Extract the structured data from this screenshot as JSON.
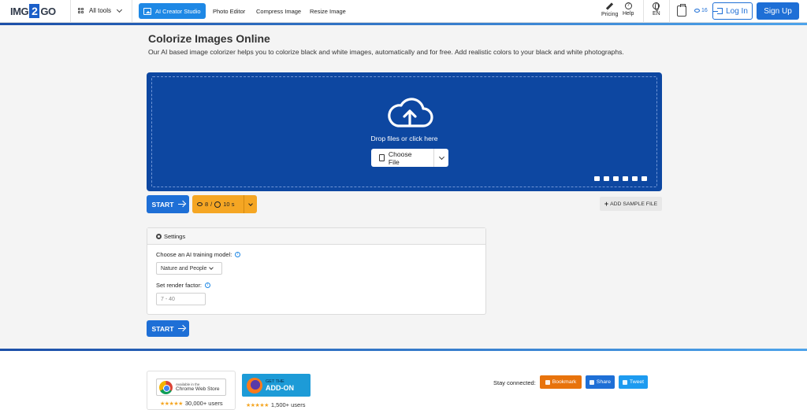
{
  "header": {
    "logo": {
      "pre": "IMG",
      "mid": "2",
      "post": "GO"
    },
    "all_tools": "All tools",
    "ai_button": "AI Creator Studio",
    "nav": [
      "Photo Editor",
      "Compress Image",
      "Resize Image"
    ],
    "pricing": "Pricing",
    "help": "Help",
    "help_icon_glyph": "?",
    "language": "EN",
    "credits": "16",
    "login": "Log In",
    "signup": "Sign Up"
  },
  "main": {
    "title": "Colorize Images Online",
    "subtitle": "Our AI based image colorizer helps you to colorize black and white images, automatically and for free. Add realistic colors to your black and white photographs.",
    "dropzone": {
      "text": "Drop files or click here",
      "choose_file": "Choose File",
      "source_icons": [
        "folder-icon",
        "link-icon",
        "google-drive-icon",
        "onedrive-icon",
        "dropbox-icon",
        "clipboard-icon"
      ]
    },
    "start": "START",
    "cost": {
      "credits": "8",
      "separator": "/",
      "time": "10 s"
    },
    "add_sample": "ADD SAMPLE FILE",
    "settings": {
      "title": "Settings",
      "model_label": "Choose an AI training model:",
      "model_value": "Nature and People",
      "render_label": "Set render factor:",
      "render_placeholder": "7 - 40",
      "info_glyph": "i"
    }
  },
  "footer": {
    "chrome_badge_small": "Available in the",
    "chrome_badge_big": "Chrome Web Store",
    "chrome_users": "30,000+ users",
    "addon_small": "GET THE",
    "addon_big": "ADD-ON",
    "addon_users": "1,500+ users",
    "stars": "★★★★★",
    "stay_connected": "Stay connected:",
    "bookmark": "Bookmark",
    "share": "Share",
    "tweet": "Tweet"
  },
  "colors": {
    "primary": "#1e6fd6",
    "dropzone": "#0d47a1",
    "orange": "#f5a623",
    "bookmark": "#e8730c",
    "share": "#1e6fd6",
    "tweet": "#1d9bf0"
  }
}
